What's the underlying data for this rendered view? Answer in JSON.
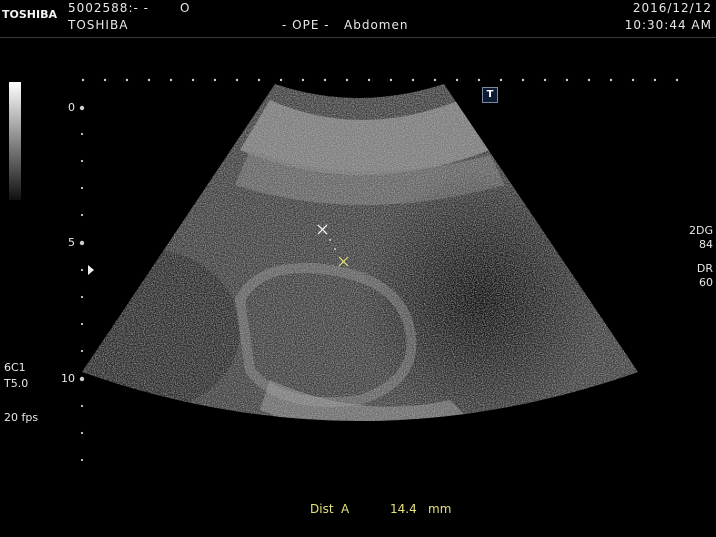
{
  "header": {
    "logo": "TOSHIBA",
    "patient_id": "5002588:- -",
    "patient_mark": "O",
    "brand": "TOSHIBA",
    "exam": "- OPE -   Abdomen",
    "date": "2016/12/12",
    "time": "10:30:44 AM"
  },
  "depth_scale": {
    "labels": [
      "0",
      "5",
      "10"
    ]
  },
  "probe": {
    "name": "6C1",
    "setting": "T5.0",
    "frame_rate": "20 fps"
  },
  "parameters": [
    {
      "label": "2DG",
      "value": "84"
    },
    {
      "label": "DR",
      "value": "60"
    }
  ],
  "body_mark": "T",
  "measurement": {
    "name": "Dist",
    "id": "A",
    "value": "14.4",
    "unit": "mm"
  },
  "colors": {
    "measurement": "#e6e27a",
    "caliper_a": "#ffffff",
    "caliper_b": "#e6e27a"
  }
}
